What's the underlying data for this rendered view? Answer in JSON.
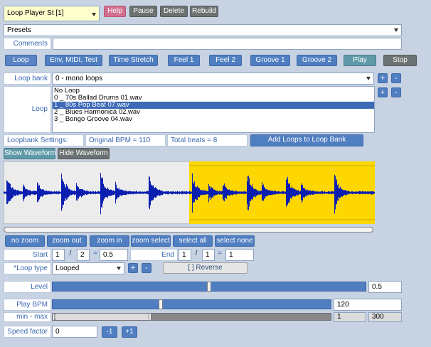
{
  "header": {
    "instrument": "Loop Player St [1]",
    "help": "Help",
    "pause": "Pause",
    "delete": "Delete",
    "rebuild": "Rebuild",
    "presets": "Presets",
    "comments_label": "Comments",
    "comments_value": ""
  },
  "tabs": [
    {
      "label": "Loop"
    },
    {
      "label": "Env, MIDI, Test"
    },
    {
      "label": "Time Stretch"
    },
    {
      "label": "Feel 1"
    },
    {
      "label": "Feel 2"
    },
    {
      "label": "Groove 1"
    },
    {
      "label": "Groove 2"
    },
    {
      "label": "Play"
    },
    {
      "label": "Stop"
    }
  ],
  "loop_bank": {
    "label": "Loop bank",
    "value": "0 - mono loops",
    "plus": "+",
    "minus": "-"
  },
  "loop": {
    "label": "Loop",
    "items": [
      "No Loop",
      "0 _ 70s Ballad Drums 01.wav",
      "1 _ 80s Pop Beat 07.wav",
      "2 _ Blues Harmonica 02.wav",
      "3 _ Bongo Groove 04.wav"
    ],
    "selected_index": 2,
    "plus": "+",
    "minus": "-"
  },
  "settings": {
    "label": "Loopbank Settings:",
    "original_bpm": "Original BPM = 110",
    "total_beats": "Total beats = 8",
    "add_button": "Add Loops to Loop Bank"
  },
  "waveform": {
    "show": "Show Waveform",
    "hide": "Hide Waveform",
    "colors": {
      "background": "#ececec",
      "selection": "#ffd700",
      "wave": "#0a1fb0",
      "marker": "#c8a800"
    },
    "selection_start_fraction": 0.5,
    "scroll_fraction": 1.0
  },
  "zoom": {
    "no_zoom": "no zoom",
    "zoom_out": "zoom out",
    "zoom_in": "zoom in",
    "zoom_select": "zoom select",
    "select_all": "select all",
    "select_none": "select none"
  },
  "range": {
    "start_label": "Start",
    "start_bar": "1",
    "start_beat": "2",
    "start_value": "0.5",
    "end_label": "End",
    "end_bar": "1",
    "end_beat": "1",
    "end_value": "1",
    "slash": "/",
    "eq": "="
  },
  "loop_type": {
    "label": "*Loop type",
    "value": "Looped",
    "plus": "+",
    "minus": "-",
    "reverse": "[ ] Reverse"
  },
  "level": {
    "label": "Level",
    "value": "0.5",
    "fraction": 0.5
  },
  "play_bpm": {
    "label": "Play BPM",
    "value": "120",
    "fraction": 0.39
  },
  "min_max": {
    "label": "min - max",
    "min": "1",
    "max": "300",
    "fraction": 0.35
  },
  "speed": {
    "label": "Speed factor",
    "value": "0",
    "minus": "-1",
    "plus": "+1"
  }
}
